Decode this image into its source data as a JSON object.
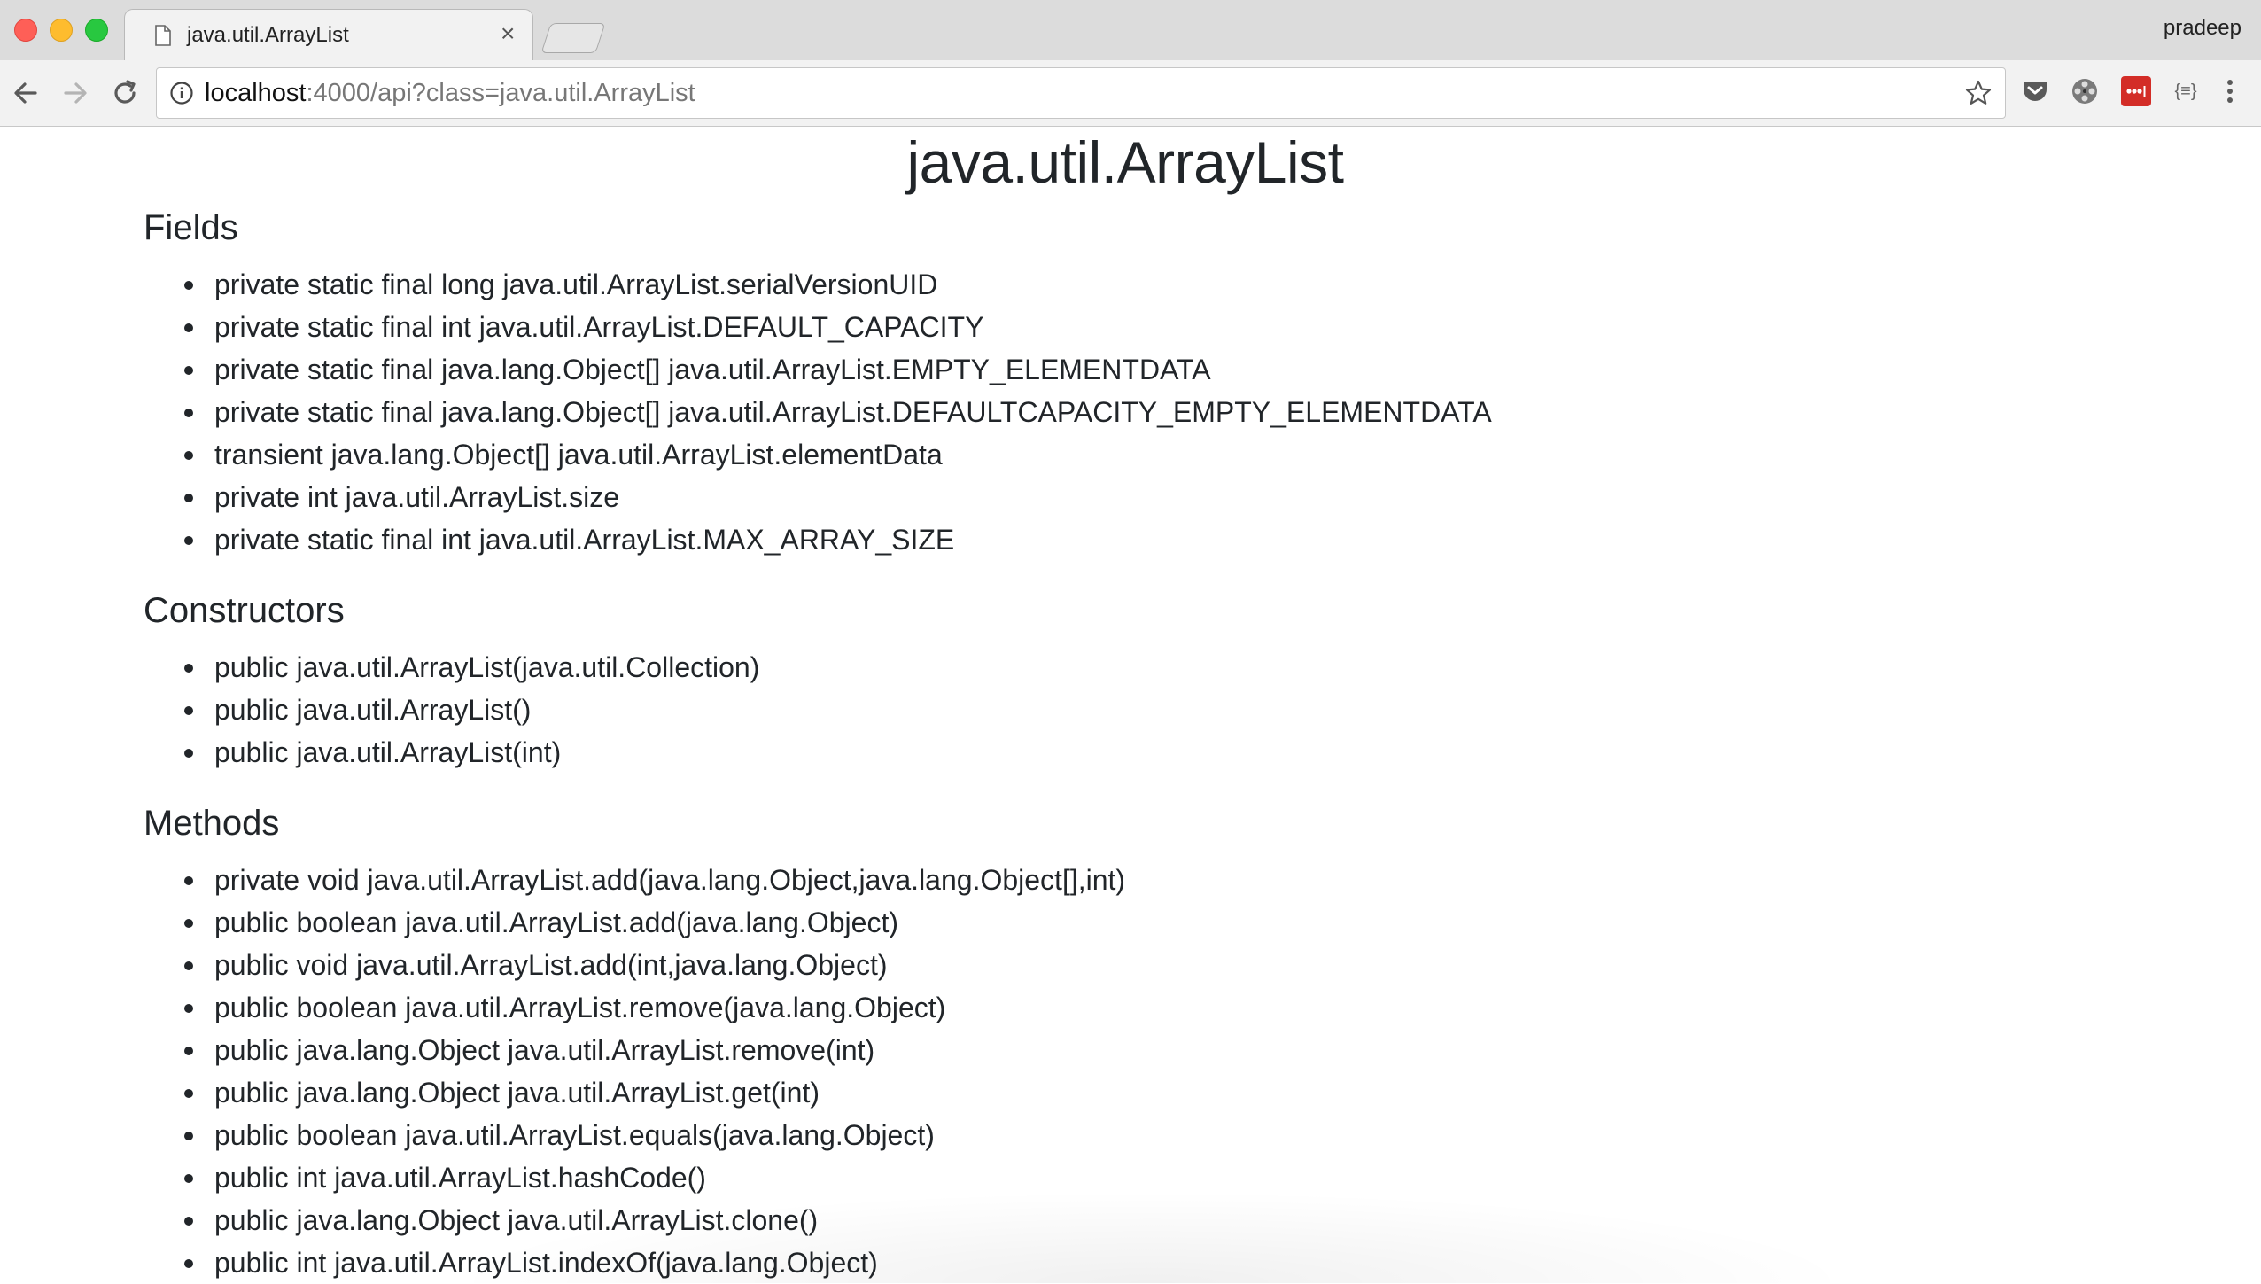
{
  "browser": {
    "tab": {
      "title": "java.util.ArrayList",
      "close_glyph": "×"
    },
    "profile_name": "pradeep",
    "address_bar": {
      "host": "localhost",
      "rest": ":4000/api?class=java.util.ArrayList"
    },
    "extensions": {
      "json_glyph": "{≡}"
    },
    "colors": {
      "chrome_bg": "#f2f2f2",
      "tabstrip_bg": "#dcdcdc",
      "lastpass_red": "#d32d27"
    }
  },
  "page": {
    "title": "java.util.ArrayList",
    "sections": {
      "fields": {
        "heading": "Fields",
        "items": [
          "private static final long java.util.ArrayList.serialVersionUID",
          "private static final int java.util.ArrayList.DEFAULT_CAPACITY",
          "private static final java.lang.Object[] java.util.ArrayList.EMPTY_ELEMENTDATA",
          "private static final java.lang.Object[] java.util.ArrayList.DEFAULTCAPACITY_EMPTY_ELEMENTDATA",
          "transient java.lang.Object[] java.util.ArrayList.elementData",
          "private int java.util.ArrayList.size",
          "private static final int java.util.ArrayList.MAX_ARRAY_SIZE"
        ]
      },
      "constructors": {
        "heading": "Constructors",
        "items": [
          "public java.util.ArrayList(java.util.Collection)",
          "public java.util.ArrayList()",
          "public java.util.ArrayList(int)"
        ]
      },
      "methods": {
        "heading": "Methods",
        "items": [
          "private void java.util.ArrayList.add(java.lang.Object,java.lang.Object[],int)",
          "public boolean java.util.ArrayList.add(java.lang.Object)",
          "public void java.util.ArrayList.add(int,java.lang.Object)",
          "public boolean java.util.ArrayList.remove(java.lang.Object)",
          "public java.lang.Object java.util.ArrayList.remove(int)",
          "public java.lang.Object java.util.ArrayList.get(int)",
          "public boolean java.util.ArrayList.equals(java.lang.Object)",
          "public int java.util.ArrayList.hashCode()",
          "public java.lang.Object java.util.ArrayList.clone()",
          "public int java.util.ArrayList.indexOf(java.lang.Object)"
        ]
      }
    }
  }
}
